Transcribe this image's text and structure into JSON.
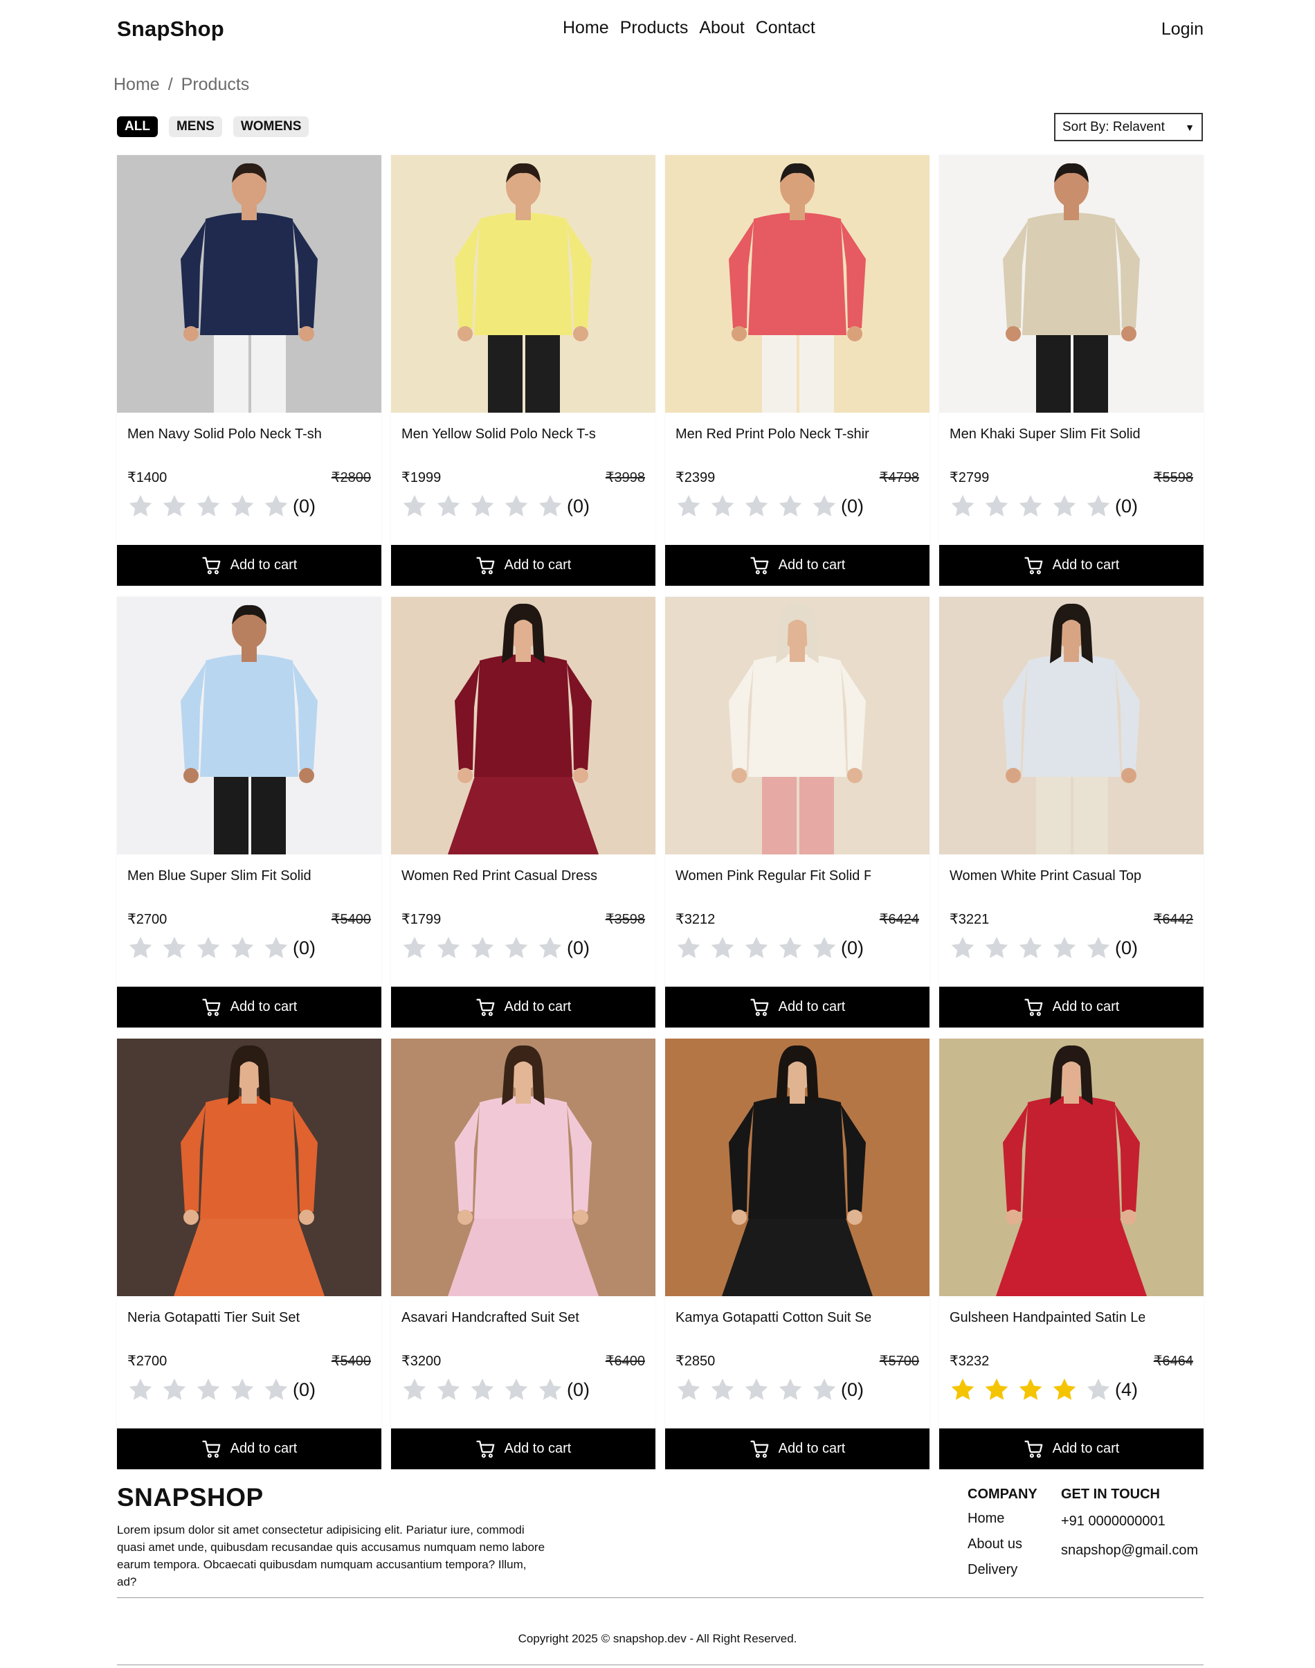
{
  "header": {
    "brand": "SnapShop",
    "nav": [
      "Home",
      "Products",
      "About",
      "Contact"
    ],
    "login": "Login"
  },
  "breadcrumb": {
    "home": "Home",
    "current": "Products"
  },
  "filters": {
    "tabs": [
      "ALL",
      "MENS",
      "WOMENS"
    ],
    "active": "ALL",
    "sort_label": "Sort By: Relavent"
  },
  "add_to_cart_label": "Add to cart",
  "colors": {
    "star_filled": "#f5c400",
    "star_empty": "#d4d7db",
    "button": "#000000"
  },
  "products": [
    {
      "title": "Men Navy Solid Polo Neck T-shi",
      "price": "₹1400",
      "old_price": "₹2800",
      "rating": 0,
      "rating_count": "(0)",
      "image": "man-navy-polo"
    },
    {
      "title": "Men Yellow Solid Polo Neck T-s",
      "price": "₹1999",
      "old_price": "₹3998",
      "rating": 0,
      "rating_count": "(0)",
      "image": "man-yellow-polo"
    },
    {
      "title": "Men Red Print Polo Neck T-shir",
      "price": "₹2399",
      "old_price": "₹4798",
      "rating": 0,
      "rating_count": "(0)",
      "image": "man-red-polo"
    },
    {
      "title": "Men Khaki Super Slim Fit Solid",
      "price": "₹2799",
      "old_price": "₹5598",
      "rating": 0,
      "rating_count": "(0)",
      "image": "man-khaki-shirt"
    },
    {
      "title": "Men Blue Super Slim Fit Solid",
      "price": "₹2700",
      "old_price": "₹5400",
      "rating": 0,
      "rating_count": "(0)",
      "image": "man-blue-shirt"
    },
    {
      "title": "Women Red Print Casual Dress",
      "price": "₹1799",
      "old_price": "₹3598",
      "rating": 0,
      "rating_count": "(0)",
      "image": "woman-red-dress"
    },
    {
      "title": "Women Pink Regular Fit Solid F",
      "price": "₹3212",
      "old_price": "₹6424",
      "rating": 0,
      "rating_count": "(0)",
      "image": "woman-pink-trousers"
    },
    {
      "title": "Women White Print Casual Top",
      "price": "₹3221",
      "old_price": "₹6442",
      "rating": 0,
      "rating_count": "(0)",
      "image": "woman-white-top"
    },
    {
      "title": "Neria Gotapatti Tier Suit Set",
      "price": "₹2700",
      "old_price": "₹5400",
      "rating": 0,
      "rating_count": "(0)",
      "image": "woman-orange-suit"
    },
    {
      "title": "Asavari Handcrafted Suit Set",
      "price": "₹3200",
      "old_price": "₹6400",
      "rating": 0,
      "rating_count": "(0)",
      "image": "woman-pink-suit"
    },
    {
      "title": "Kamya Gotapatti Cotton Suit Se",
      "price": "₹2850",
      "old_price": "₹5700",
      "rating": 0,
      "rating_count": "(0)",
      "image": "woman-black-suit"
    },
    {
      "title": "Gulsheen Handpainted Satin Leh",
      "price": "₹3232",
      "old_price": "₹6464",
      "rating": 4,
      "rating_count": "(4)",
      "image": "woman-red-lehenga"
    }
  ],
  "footer": {
    "brand": "SNAPSHOP",
    "description": "Lorem ipsum dolor sit amet consectetur adipisicing elit. Pariatur iure, commodi quasi amet unde, quibusdam recusandae quis accusamus numquam nemo labore earum tempora. Obcaecati quibusdam numquam accusantium tempora? Illum, ad?",
    "company": {
      "heading": "COMPANY",
      "links": [
        "Home",
        "About us",
        "Delivery"
      ]
    },
    "contact": {
      "heading": "GET IN TOUCH",
      "items": [
        "+91 0000000001",
        "snapshop@gmail.com"
      ]
    },
    "copyright": "Copyright 2025 © snapshop.dev - All Right Reserved."
  }
}
